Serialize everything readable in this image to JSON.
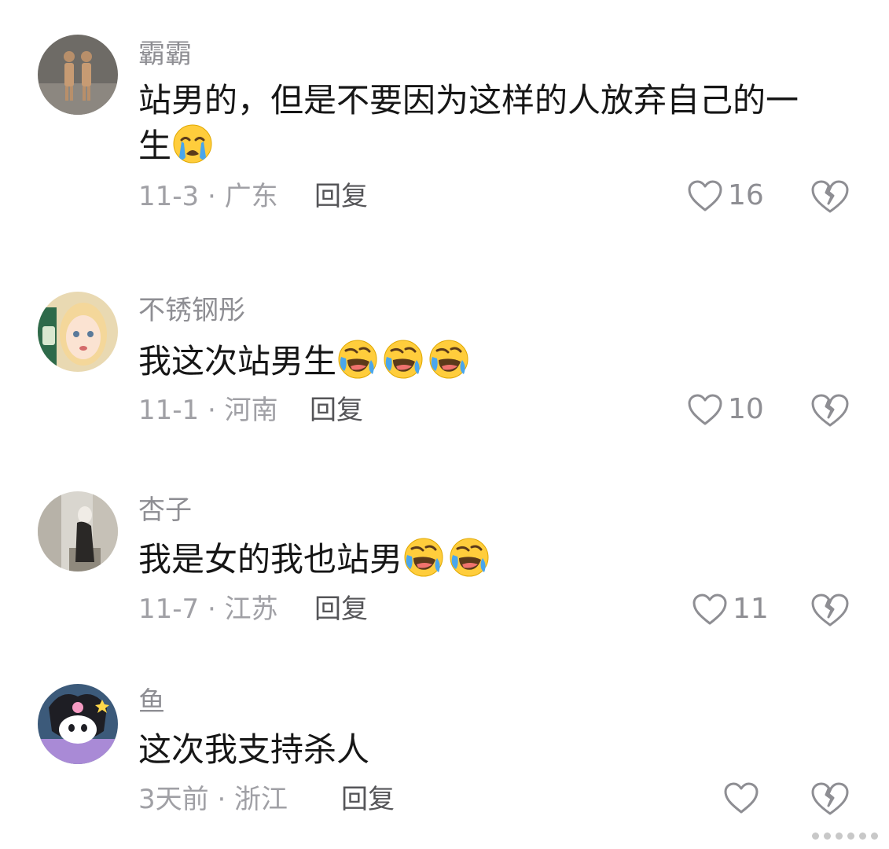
{
  "comments": [
    {
      "username": "霸霸",
      "text": "站男的，但是不要因为这样的人放弃自己的一生",
      "text_line1": "站男的，但是不要因为这样的人放弃自己的一",
      "text_line2": "生",
      "emojis": [
        "loudly-crying-face-emoji"
      ],
      "date": "11-3",
      "location": "广东",
      "meta": "11-3 · 广东",
      "reply_label": "回复",
      "likes": "16"
    },
    {
      "username": "不锈钢彤",
      "text": "我这次站男生",
      "emojis": [
        "rolling-laughing-face-emoji",
        "rolling-laughing-face-emoji",
        "rolling-laughing-face-emoji"
      ],
      "date": "11-1",
      "location": "河南",
      "meta": "11-1 · 河南",
      "reply_label": "回复",
      "likes": "10"
    },
    {
      "username": "杏子",
      "text": "我是女的我也站男",
      "emojis": [
        "rolling-laughing-face-emoji",
        "rolling-laughing-face-emoji"
      ],
      "date": "11-7",
      "location": "江苏",
      "meta": "11-7 · 江苏",
      "reply_label": "回复",
      "likes": "11"
    },
    {
      "username": "鱼",
      "text": "这次我支持杀人",
      "emojis": [],
      "date": "3天前",
      "location": "浙江",
      "meta": "3天前 · 浙江",
      "reply_label": "回复",
      "likes": ""
    }
  ],
  "icons": {
    "like": "heart-outline-icon",
    "dislike": "broken-heart-outline-icon"
  },
  "colors": {
    "username": "#8e8e93",
    "body_text": "#161616",
    "meta": "#a0a0a5",
    "reply": "#555558",
    "icon_stroke": "#8e8e93",
    "background": "#ffffff"
  }
}
